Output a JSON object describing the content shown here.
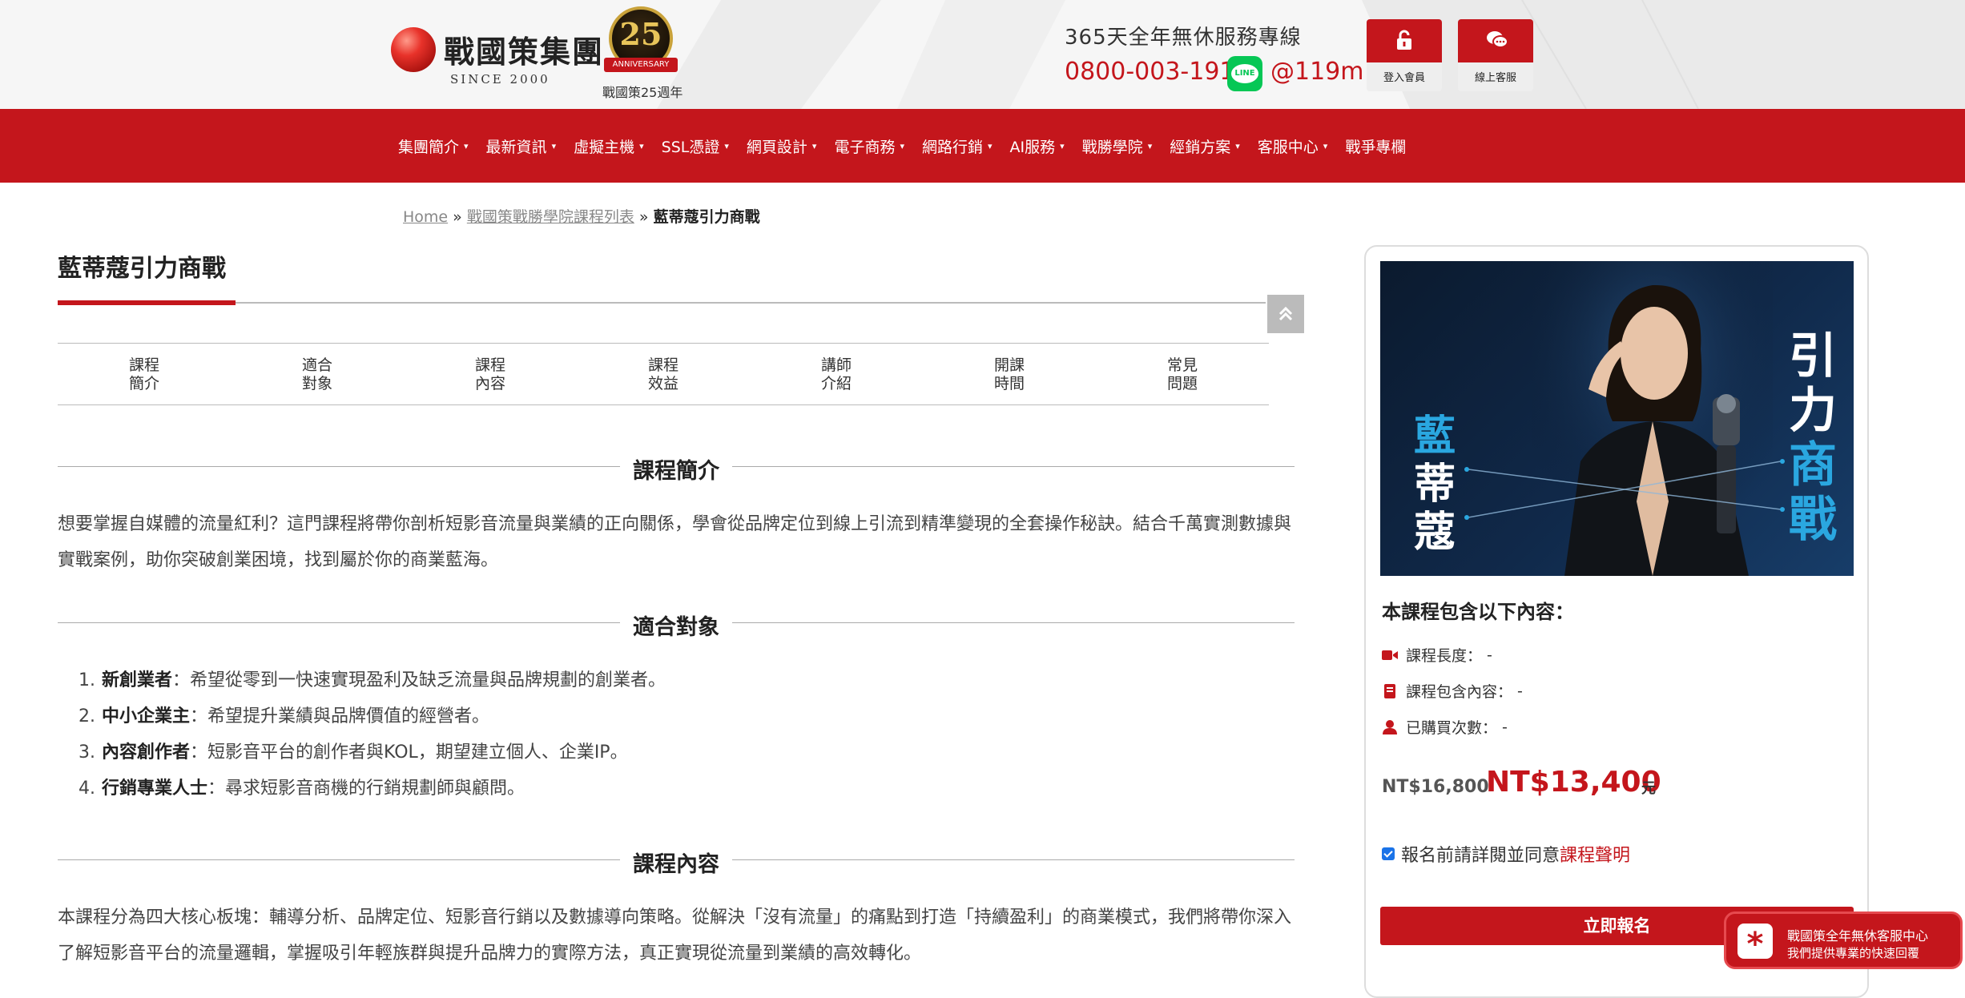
{
  "header": {
    "logo_text": "戰國策集團",
    "logo_since": "SINCE 2000",
    "anniversary_number": "25",
    "anniversary_ribbon": "ANNIVERSARY",
    "anniversary_label": "戰國策25週年",
    "service_text": "365天全年無休服務專線",
    "phone": "0800-003-191",
    "line_icon": "line-icon",
    "line_id": "@119m",
    "login_label": "登入會員",
    "chat_label": "線上客服"
  },
  "nav": {
    "items": [
      {
        "label": "集團簡介",
        "has_caret": true
      },
      {
        "label": "最新資訊",
        "has_caret": true
      },
      {
        "label": "虛擬主機",
        "has_caret": true
      },
      {
        "label": "SSL憑證",
        "has_caret": true
      },
      {
        "label": "網頁設計",
        "has_caret": true
      },
      {
        "label": "電子商務",
        "has_caret": true
      },
      {
        "label": "網路行銷",
        "has_caret": true
      },
      {
        "label": "AI服務",
        "has_caret": true
      },
      {
        "label": "戰勝學院",
        "has_caret": true
      },
      {
        "label": "經銷方案",
        "has_caret": true
      },
      {
        "label": "客服中心",
        "has_caret": true
      },
      {
        "label": "戰爭專欄",
        "has_caret": false
      }
    ]
  },
  "breadcrumb": {
    "home": "Home",
    "sep": " » ",
    "list": "戰國策戰勝學院課程列表",
    "current": "藍蒂蔻引力商戰"
  },
  "main": {
    "title": "藍蒂蔻引力商戰",
    "tabs": [
      {
        "line1": "課程",
        "line2": "簡介"
      },
      {
        "line1": "適合",
        "line2": "對象"
      },
      {
        "line1": "課程",
        "line2": "內容"
      },
      {
        "line1": "課程",
        "line2": "效益"
      },
      {
        "line1": "講師",
        "line2": "介紹"
      },
      {
        "line1": "開課",
        "line2": "時間"
      },
      {
        "line1": "常見",
        "line2": "問題"
      }
    ],
    "intro_heading": "課程簡介",
    "intro_text": "想要掌握自媒體的流量紅利？這門課程將帶你剖析短影音流量與業績的正向關係，學會從品牌定位到線上引流到精準變現的全套操作秘訣。結合千萬實測數據與實戰案例，助你突破創業困境，找到屬於你的商業藍海。",
    "audience_heading": "適合對象",
    "audience": [
      {
        "num": "1.",
        "title": "新創業者",
        "text": "：希望從零到一快速實現盈利及缺乏流量與品牌規劃的創業者。"
      },
      {
        "num": "2.",
        "title": "中小企業主",
        "text": "：希望提升業績與品牌價值的經營者。"
      },
      {
        "num": "3.",
        "title": "內容創作者",
        "text": "：短影音平台的創作者與KOL，期望建立個人、企業IP。"
      },
      {
        "num": "4.",
        "title": "行銷專業人士",
        "text": "：尋求短影音商機的行銷規劃師與顧問。"
      }
    ],
    "content_heading": "課程內容",
    "content_text": "本課程分為四大核心板塊：輔導分析、品牌定位、短影音行銷以及數據導向策略。從解決「沒有流量」的痛點到打造「持續盈利」的商業模式，我們將帶你深入了解短影音平台的流量邏輯，掌握吸引年輕族群與提升品牌力的實際方法，真正實現從流量到業績的高效轉化。"
  },
  "sidebar": {
    "banner": {
      "left_chars": [
        "藍",
        "蒂",
        "蔻"
      ],
      "right_chars": [
        "引",
        "力",
        "商",
        "戰"
      ]
    },
    "includes_title": "本課程包含以下內容：",
    "rows": [
      {
        "icon": "video-camera-icon",
        "label": "課程長度：",
        "value": "-"
      },
      {
        "icon": "book-icon",
        "label": "課程包含內容：",
        "value": "-"
      },
      {
        "icon": "user-icon",
        "label": "已購買次數：",
        "value": "-"
      }
    ],
    "price_old": "NT$16,800",
    "price_new": "NT$13,400",
    "price_unit": "元",
    "agree_text": "報名前請詳閱並同意",
    "agree_link": "課程聲明",
    "enroll_label": "立即報名"
  },
  "floating_cs": {
    "line1": "戰國策全年無休客服中心",
    "line2": "我們提供專業的快速回覆"
  },
  "colors": {
    "brand_red": "#c4161c",
    "line_green": "#06c755",
    "banner_blue": "#2aa7e0"
  }
}
